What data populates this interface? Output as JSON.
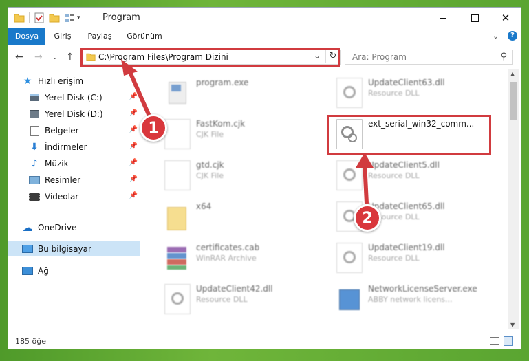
{
  "window": {
    "title": "Program",
    "controls": [
      "minimize",
      "maximize",
      "close"
    ]
  },
  "ribbon": {
    "tabs": [
      {
        "label": "Dosya",
        "active": true
      },
      {
        "label": "Giriş",
        "active": false
      },
      {
        "label": "Paylaş",
        "active": false
      },
      {
        "label": "Görünüm",
        "active": false
      }
    ]
  },
  "address_bar": {
    "path": "C:\\Program Files\\Program Dizini"
  },
  "search": {
    "placeholder": "Ara: Program"
  },
  "sidebar": {
    "items": [
      {
        "label": "Hızlı erişim",
        "icon": "star-icon",
        "pinned": false
      },
      {
        "label": "Yerel Disk (C:)",
        "icon": "drive-icon",
        "pinned": true
      },
      {
        "label": "Yerel Disk (D:)",
        "icon": "drive-icon",
        "pinned": true
      },
      {
        "label": "Belgeler",
        "icon": "documents-icon",
        "pinned": true
      },
      {
        "label": "İndirmeler",
        "icon": "download-icon",
        "pinned": true
      },
      {
        "label": "Müzik",
        "icon": "music-icon",
        "pinned": true
      },
      {
        "label": "Resimler",
        "icon": "pictures-icon",
        "pinned": true
      },
      {
        "label": "Videolar",
        "icon": "video-icon",
        "pinned": true
      },
      {
        "label": "OneDrive",
        "icon": "cloud-icon",
        "pinned": false
      },
      {
        "label": "Bu bilgisayar",
        "icon": "computer-icon",
        "pinned": false,
        "selected": true
      },
      {
        "label": "Ağ",
        "icon": "network-icon",
        "pinned": false
      }
    ]
  },
  "files": [
    {
      "name": "program.exe",
      "type": "",
      "icon": "exe-icon"
    },
    {
      "name": "UpdateClient63.dll",
      "type": "Resource DLL",
      "icon": "dll-icon"
    },
    {
      "name": "FastKom.cjk",
      "type": "CJK File",
      "icon": "file-icon"
    },
    {
      "name": "ext_serial_win32_comm...",
      "type": "",
      "icon": "dll-icon",
      "highlighted": true
    },
    {
      "name": "gtd.cjk",
      "type": "CJK File",
      "icon": "file-icon"
    },
    {
      "name": "UpdateClient5.dll",
      "type": "Resource DLL",
      "icon": "dll-icon"
    },
    {
      "name": "x64",
      "type": "",
      "icon": "folder-icon"
    },
    {
      "name": "UpdateClient65.dll",
      "type": "Resource DLL",
      "icon": "dll-icon"
    },
    {
      "name": "certificates.cab",
      "type": "WinRAR Archive",
      "icon": "archive-icon"
    },
    {
      "name": "UpdateClient19.dll",
      "type": "Resource DLL",
      "icon": "dll-icon"
    },
    {
      "name": "UpdateClient42.dll",
      "type": "Resource DLL",
      "icon": "dll-icon"
    },
    {
      "name": "NetworkLicenseServer.exe",
      "type": "ABBY network licens...",
      "icon": "app-icon"
    }
  ],
  "status": {
    "count_text": "185 öğe"
  },
  "annotations": {
    "step1": "1",
    "step2": "2",
    "color": "#d13b3f"
  }
}
